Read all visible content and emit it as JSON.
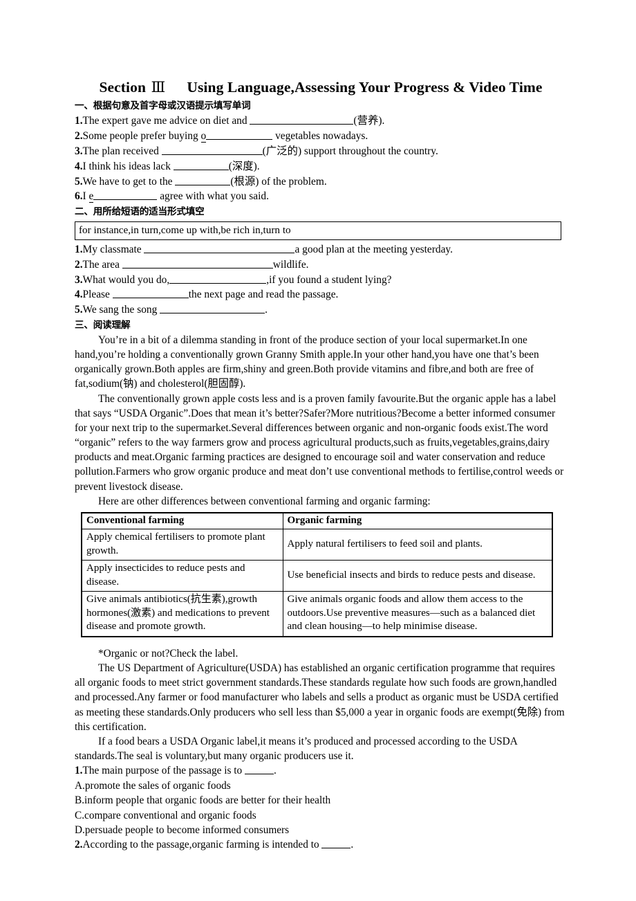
{
  "title": {
    "prefix": "Section",
    "numeral": "Ⅲ",
    "main": "Using Language,Assessing Your Progress & Video Time"
  },
  "section1": {
    "heading": "一、根据句意及首字母或汉语提示填写单词",
    "items": [
      {
        "num": "1.",
        "pre": "The expert gave me advice on diet and ",
        "blank_width": 150,
        "post": "(营养).",
        "lead": ""
      },
      {
        "num": "2.",
        "pre": "Some people prefer buying ",
        "blank_width": 96,
        "post": " vegetables nowadays.",
        "lead": "o"
      },
      {
        "num": "3.",
        "pre": "The plan received ",
        "blank_width": 146,
        "post": "(广泛的) support throughout the country.",
        "lead": ""
      },
      {
        "num": "4.",
        "pre": "I think his ideas lack ",
        "blank_width": 80,
        "post": "(深度).",
        "lead": ""
      },
      {
        "num": "5.",
        "pre": "We have to get to the ",
        "blank_width": 80,
        "post": "(根源) of the problem.",
        "lead": ""
      },
      {
        "num": "6.",
        "pre": "I ",
        "blank_width": 92,
        "post": " agree with what you said.",
        "lead": "e"
      }
    ]
  },
  "section2": {
    "heading": "二、用所给短语的适当形式填空",
    "phrase_bank": "for instance,in turn,come up with,be rich in,turn to",
    "items": [
      {
        "num": "1.",
        "pre": "My classmate ",
        "blank_width": 218,
        "post": "a good plan at the meeting yesterday."
      },
      {
        "num": "2.",
        "pre": "The area ",
        "blank_width": 218,
        "post": "wildlife."
      },
      {
        "num": "3.",
        "pre": "What would you do,",
        "blank_width": 140,
        "post": ",if you found a student lying?"
      },
      {
        "num": "4.",
        "pre": "Please ",
        "blank_width": 110,
        "post": "the next page and read the passage."
      },
      {
        "num": "5.",
        "pre": "We sang the song ",
        "blank_width": 152,
        "post": "."
      }
    ]
  },
  "section3": {
    "heading": "三、阅读理解",
    "paragraphs": [
      "You’re in a bit of a dilemma standing in front of the produce section of your local supermarket.In one hand,you’re holding a conventionally grown Granny Smith apple.In your other hand,you have one that’s been organically grown.Both apples are firm,shiny and green.Both provide vitamins and fibre,and both are free of fat,sodium(钠) and cholesterol(胆固醇).",
      "The conventionally grown apple costs less and is a proven family favourite.But the organic apple has a label that says “USDA Organic”.Does that mean it’s better?Safer?More nutritious?Become a better informed consumer for your next trip to the supermarket.Several differences between organic and non-organic foods exist.The word “organic” refers to the way farmers grow and process agricultural products,such as fruits,vegetables,grains,dairy products and meat.Organic farming practices are designed to encourage soil and water conservation and reduce pollution.Farmers who grow organic produce and meat don’t use conventional methods to fertilise,control weeds or prevent livestock disease.",
      "Here are other differences between conventional farming and organic farming:"
    ],
    "table": {
      "headers": [
        "Conventional farming",
        "Organic farming"
      ],
      "rows": [
        [
          "Apply chemical fertilisers to promote plant growth.",
          "Apply natural fertilisers to feed soil and plants."
        ],
        [
          "Apply insecticides to reduce pests and disease.",
          "Use beneficial insects and birds to reduce pests and disease."
        ],
        [
          "Give animals antibiotics(抗生素),growth hormones(激素) and medications to prevent disease and promote growth.",
          "Give animals organic foods and allow them access to the outdoors.Use preventive measures—such as a balanced diet and clean housing—to help minimise disease."
        ]
      ]
    },
    "paragraphs_after": [
      "*Organic or not?Check the label.",
      "The US Department of Agriculture(USDA) has established an organic certification programme that requires all organic foods to meet strict government standards.These standards regulate how such foods are grown,handled and processed.Any farmer or food manufacturer who labels and sells a product as organic must be USDA certified as meeting these standards.Only producers who sell less than $5,000 a year in organic foods are exempt(免除) from this certification.",
      "If a food bears a USDA Organic label,it means it’s produced and processed according to the USDA standards.The seal is voluntary,but many organic producers use it."
    ],
    "questions": [
      {
        "num": "1.",
        "stem_pre": "The main purpose of the passage is to ",
        "stem_post": ".",
        "options": [
          "A.promote the sales of organic foods",
          "B.inform people that organic foods are better for their health",
          "C.compare conventional and organic foods",
          "D.persuade people to become informed consumers"
        ]
      },
      {
        "num": "2.",
        "stem_pre": "According to the passage,organic farming is intended to ",
        "stem_post": ".",
        "options": []
      }
    ]
  }
}
